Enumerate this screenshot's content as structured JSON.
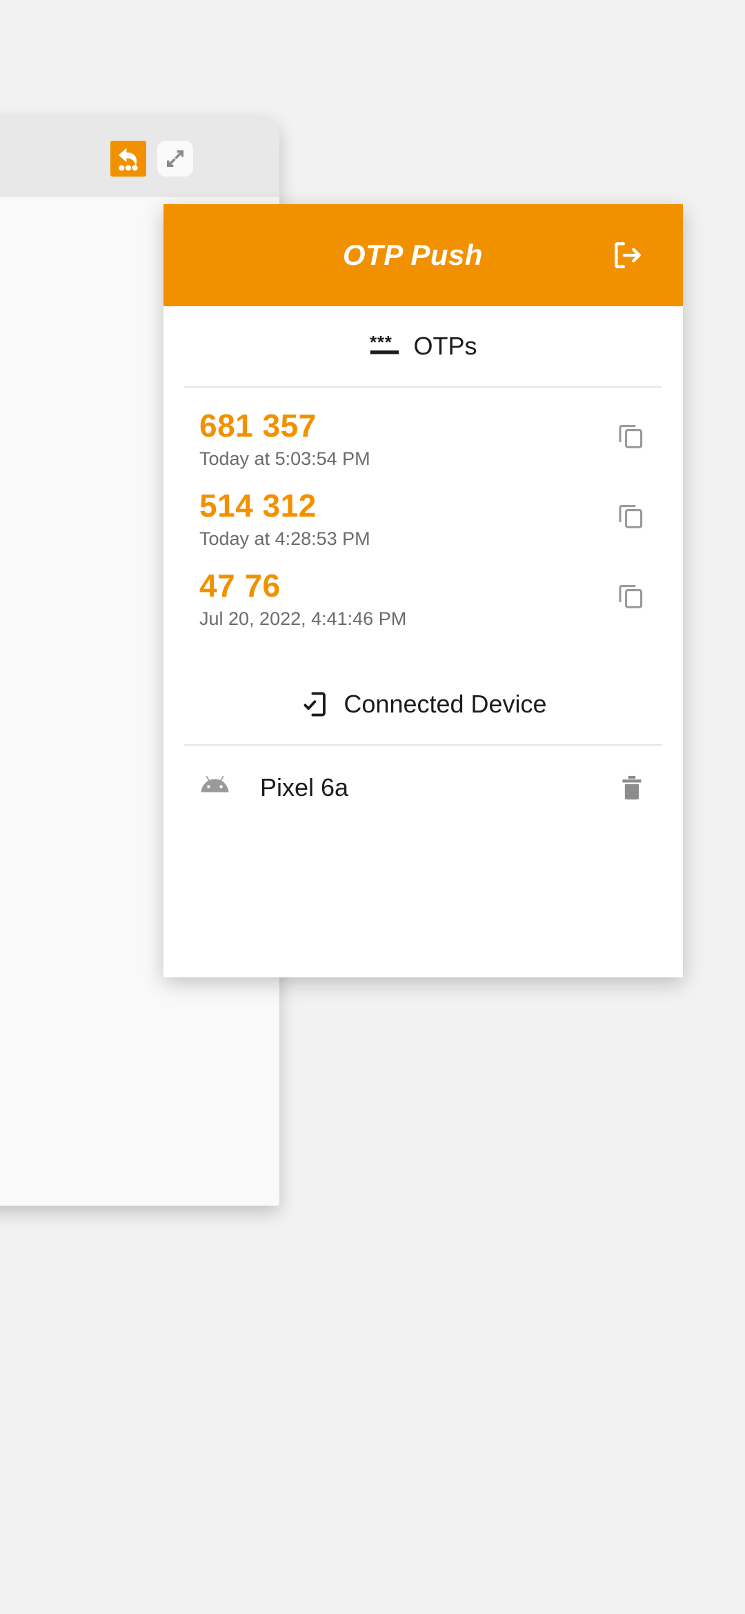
{
  "browser": {
    "reload_icon": "reload-icon",
    "extension_icon": "otp-push-extension-icon",
    "resize_icon": "resize-expand-icon"
  },
  "popup": {
    "title": "OTP Push",
    "logout_icon": "logout-icon",
    "accent_color": "#f29100",
    "otps_section": {
      "icon": "asterisk-keypad-icon",
      "heading": "OTPs",
      "copy_icon": "copy-icon",
      "items": [
        {
          "code": "681 357",
          "time": "Today at 5:03:54 PM"
        },
        {
          "code": "514 312",
          "time": "Today at 4:28:53 PM"
        },
        {
          "code": "47 76",
          "time": "Jul 20, 2022, 4:41:46 PM"
        }
      ]
    },
    "device_section": {
      "icon": "phone-check-icon",
      "heading": "Connected Device",
      "devices": [
        {
          "name": "Pixel 6a",
          "platform_icon": "android-icon",
          "delete_icon": "trash-icon"
        }
      ]
    }
  }
}
